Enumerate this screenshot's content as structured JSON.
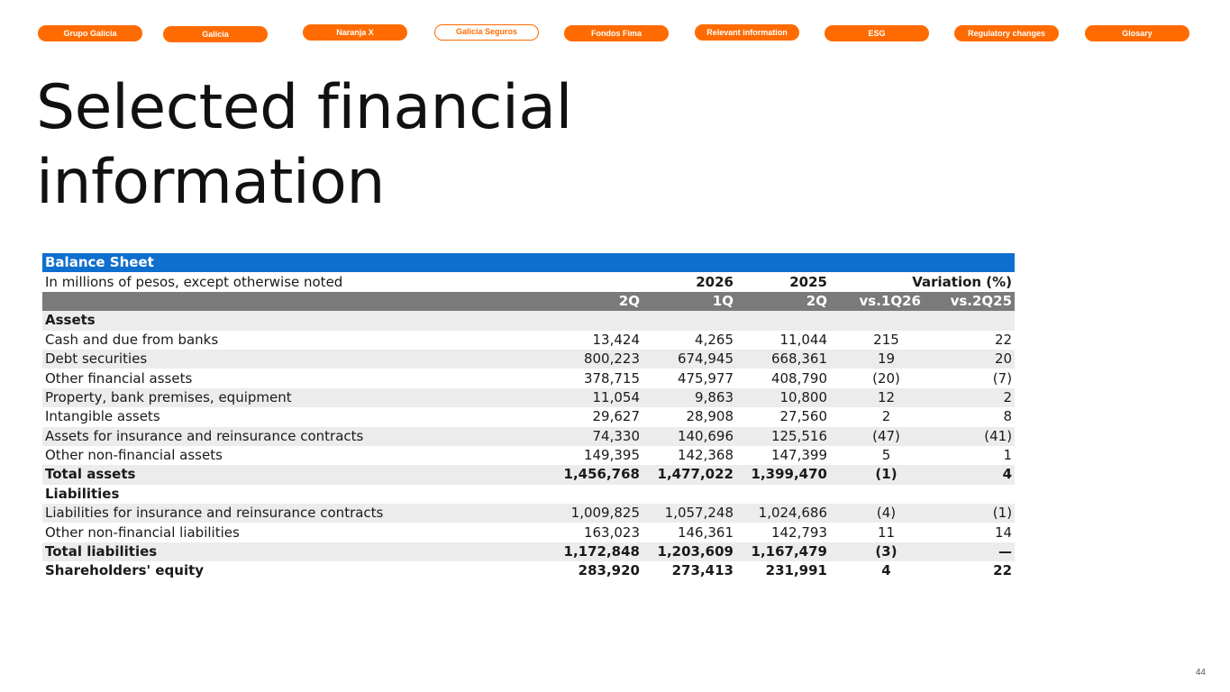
{
  "nav": {
    "items": [
      "Grupo Galicia",
      "Galicia",
      "Naranja X",
      "Galicia Seguros",
      "Fondos Fima",
      "Relevant information",
      "ESG",
      "Regulatory changes",
      "Glosary"
    ],
    "active_index": 3,
    "accent_color": "#ff6b00"
  },
  "title": "Selected financial information",
  "table": {
    "header": "Balance Sheet",
    "subheader": {
      "label": "In millions of pesos, except otherwise noted",
      "year1": "2026",
      "year2": "2025",
      "variation": "Variation (%)"
    },
    "columns": [
      "2Q",
      "1Q",
      "2Q",
      "vs.1Q26",
      "vs.2Q25"
    ],
    "rows": [
      {
        "label": "Assets",
        "values": [
          "",
          "",
          "",
          "",
          ""
        ],
        "style": "section"
      },
      {
        "label": "Cash and due from banks",
        "values": [
          "13,424",
          "4,265",
          "11,044",
          "215",
          "22"
        ]
      },
      {
        "label": "Debt securities",
        "values": [
          "800,223",
          "674,945",
          "668,361",
          "19",
          "20"
        ]
      },
      {
        "label": "Other financial assets",
        "values": [
          "378,715",
          "475,977",
          "408,790",
          "(20)",
          "(7)"
        ]
      },
      {
        "label": "Property, bank premises, equipment",
        "values": [
          "11,054",
          "9,863",
          "10,800",
          "12",
          "2"
        ]
      },
      {
        "label": "Intangible assets",
        "values": [
          "29,627",
          "28,908",
          "27,560",
          "2",
          "8"
        ]
      },
      {
        "label": "Assets for insurance and reinsurance contracts",
        "values": [
          "74,330",
          "140,696",
          "125,516",
          "(47)",
          "(41)"
        ]
      },
      {
        "label": "Other non-financial assets",
        "values": [
          "149,395",
          "142,368",
          "147,399",
          "5",
          "1"
        ]
      },
      {
        "label": "Total assets",
        "values": [
          "1,456,768",
          "1,477,022",
          "1,399,470",
          "(1)",
          "4"
        ],
        "style": "total"
      },
      {
        "label": "Liabilities",
        "values": [
          "",
          "",
          "",
          "",
          ""
        ],
        "style": "section"
      },
      {
        "label": "Liabilities for insurance and reinsurance contracts",
        "values": [
          "1,009,825",
          "1,057,248",
          "1,024,686",
          "(4)",
          "(1)"
        ]
      },
      {
        "label": "Other non-financial liabilities",
        "values": [
          "163,023",
          "146,361",
          "142,793",
          "11",
          "14"
        ]
      },
      {
        "label": "Total liabilities",
        "values": [
          "1,172,848",
          "1,203,609",
          "1,167,479",
          "(3)",
          "—"
        ],
        "style": "total"
      },
      {
        "label": "Shareholders' equity",
        "values": [
          "283,920",
          "273,413",
          "231,991",
          "4",
          "22"
        ],
        "style": "total"
      }
    ],
    "header_color": "#0f6fce",
    "column_header_color": "#7a7a7a",
    "stripe_color": "#ececec"
  },
  "page_number": "44"
}
